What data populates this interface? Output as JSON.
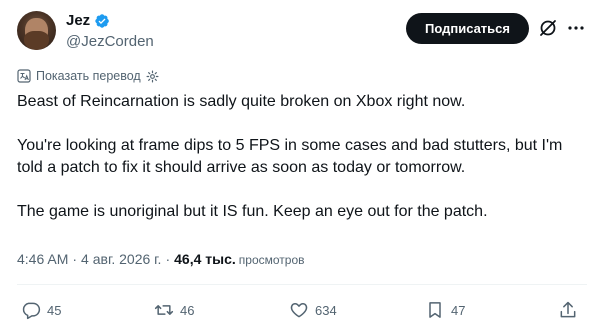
{
  "author": {
    "name": "Jez",
    "handle": "@JezCorden"
  },
  "header": {
    "follow_label": "Подписаться"
  },
  "translate_label": "Показать перевод",
  "tweet": {
    "paragraphs": [
      "Beast of Reincarnation is sadly quite broken on Xbox right now.",
      "You're looking at frame dips to 5 FPS in some cases and bad stutters, but I'm told a patch to fix it should arrive as soon as today or tomorrow.",
      "The game is unoriginal but it IS fun. Keep an eye out for the patch."
    ]
  },
  "meta": {
    "time": "4:46 AM",
    "separator": "·",
    "date": "4 авг. 2026 г.",
    "views_count": "46,4 тыс.",
    "views_label": "просмотров"
  },
  "actions": {
    "replies": "45",
    "reposts": "46",
    "likes": "634",
    "bookmarks": "47"
  },
  "icons": {
    "verified": "verified-badge-icon",
    "grok": "grok-icon",
    "more": "more-icon",
    "translate": "translate-icon",
    "reply": "reply-icon",
    "repost": "repost-icon",
    "like": "heart-icon",
    "bookmark": "bookmark-icon",
    "share": "share-icon"
  },
  "colors": {
    "verified_blue": "#1d9bf0",
    "text_primary": "#0f1419",
    "text_secondary": "#536471",
    "button_dark": "#0f1419"
  }
}
